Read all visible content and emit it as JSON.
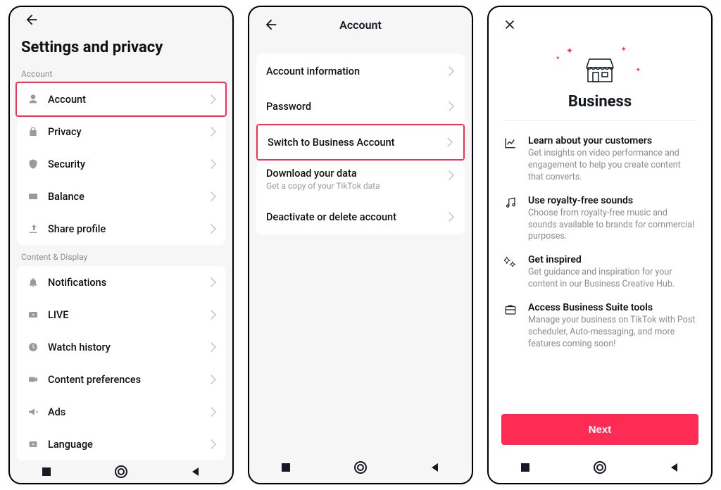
{
  "screen1": {
    "title": "Settings and privacy",
    "section_account": "Account",
    "section_content": "Content & Display",
    "account_items": [
      {
        "label": "Account",
        "icon": "person"
      },
      {
        "label": "Privacy",
        "icon": "lock"
      },
      {
        "label": "Security",
        "icon": "shield"
      },
      {
        "label": "Balance",
        "icon": "wallet"
      },
      {
        "label": "Share profile",
        "icon": "share"
      }
    ],
    "content_items": [
      {
        "label": "Notifications",
        "icon": "bell"
      },
      {
        "label": "LIVE",
        "icon": "live"
      },
      {
        "label": "Watch history",
        "icon": "clock"
      },
      {
        "label": "Content preferences",
        "icon": "video"
      },
      {
        "label": "Ads",
        "icon": "megaphone"
      },
      {
        "label": "Language",
        "icon": "language"
      }
    ]
  },
  "screen2": {
    "title": "Account",
    "items": [
      {
        "label": "Account information"
      },
      {
        "label": "Password"
      },
      {
        "label": "Switch to Business Account",
        "highlight": true
      },
      {
        "label": "Download your data",
        "sub": "Get a copy of your TikTok data"
      },
      {
        "label": "Deactivate or delete account"
      }
    ]
  },
  "screen3": {
    "title": "Business",
    "cta": "Next",
    "features": [
      {
        "title": "Learn about your customers",
        "desc": "Get insights on video performance and engagement to help you create content that converts.",
        "icon": "chart"
      },
      {
        "title": "Use royalty-free sounds",
        "desc": "Choose from royalty-free music and sounds available to brands for commercial purposes.",
        "icon": "music"
      },
      {
        "title": "Get inspired",
        "desc": "Get guidance and inspiration for your content in our Business Creative Hub.",
        "icon": "spark"
      },
      {
        "title": "Access Business Suite tools",
        "desc": "Manage your business on TikTok with Post scheduler, Auto-messaging, and more features coming soon!",
        "icon": "suite"
      }
    ]
  }
}
